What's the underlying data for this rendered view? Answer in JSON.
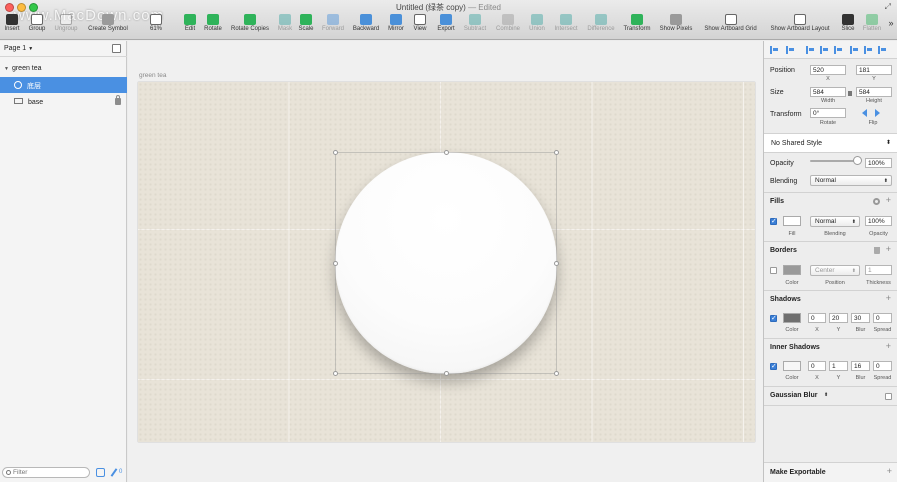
{
  "window": {
    "title": "Untitled (绿茶 copy)",
    "status": "— Edited",
    "watermark": "www.MacDown.com"
  },
  "toolbar": {
    "insert": "Insert",
    "group": "Group",
    "ungroup": "Ungroup",
    "create_symbol": "Create Symbol",
    "zoom": "61%",
    "edit": "Edit",
    "rotate": "Rotate",
    "rotate_copies": "Rotate Copies",
    "mask": "Mask",
    "scale": "Scale",
    "forward": "Forward",
    "backward": "Backward",
    "mirror": "Mirror",
    "view": "View",
    "export": "Export",
    "subtract": "Subtract",
    "combine": "Combine",
    "union": "Union",
    "intersect": "Intersect",
    "difference": "Difference",
    "transform": "Transform",
    "show_pixels": "Show Pixels",
    "show_artboard_grid": "Show Artboard Grid",
    "show_artboard_layout": "Show Artboard Layout",
    "slice": "Slice",
    "flatten": "Flatten",
    "more": "»"
  },
  "layers": {
    "page": "Page 1",
    "group": "green tea",
    "selected_layer": "底层",
    "base_layer": "base",
    "filter_placeholder": "Filter",
    "count": "0"
  },
  "canvas": {
    "artboard_label": "green tea"
  },
  "inspector": {
    "position_label": "Position",
    "position_x": "520",
    "position_y": "181",
    "x_label": "X",
    "y_label": "Y",
    "size_label": "Size",
    "width": "584",
    "height": "584",
    "width_label": "Width",
    "height_label": "Height",
    "transform_label": "Transform",
    "rotate_value": "0°",
    "rotate_label": "Rotate",
    "flip_label": "Flip",
    "shared_style": "No Shared Style",
    "opacity_label": "Opacity",
    "opacity_value": "100%",
    "blending_label": "Blending",
    "blending_value": "Normal",
    "fills_title": "Fills",
    "fill_blending": "Normal",
    "fill_opacity": "100%",
    "fill_label": "Fill",
    "fill_blending_label": "Blending",
    "fill_opacity_label": "Opacity",
    "borders_title": "Borders",
    "border_position": "Center",
    "border_thickness": "1",
    "color_label": "Color",
    "position_sub_label": "Position",
    "thickness_label": "Thickness",
    "shadows_title": "Shadows",
    "shadow_x": "0",
    "shadow_y": "20",
    "shadow_blur": "30",
    "shadow_spread": "0",
    "blur_label": "Blur",
    "spread_label": "Spread",
    "inner_shadows_title": "Inner Shadows",
    "inner_x": "0",
    "inner_y": "1",
    "inner_blur": "16",
    "inner_spread": "0",
    "gaussian_blur": "Gaussian Blur",
    "make_exportable": "Make Exportable"
  },
  "colors": {
    "accent": "#4a90e2",
    "artboard": "#e8e3d8",
    "circle": "#ffffff"
  }
}
